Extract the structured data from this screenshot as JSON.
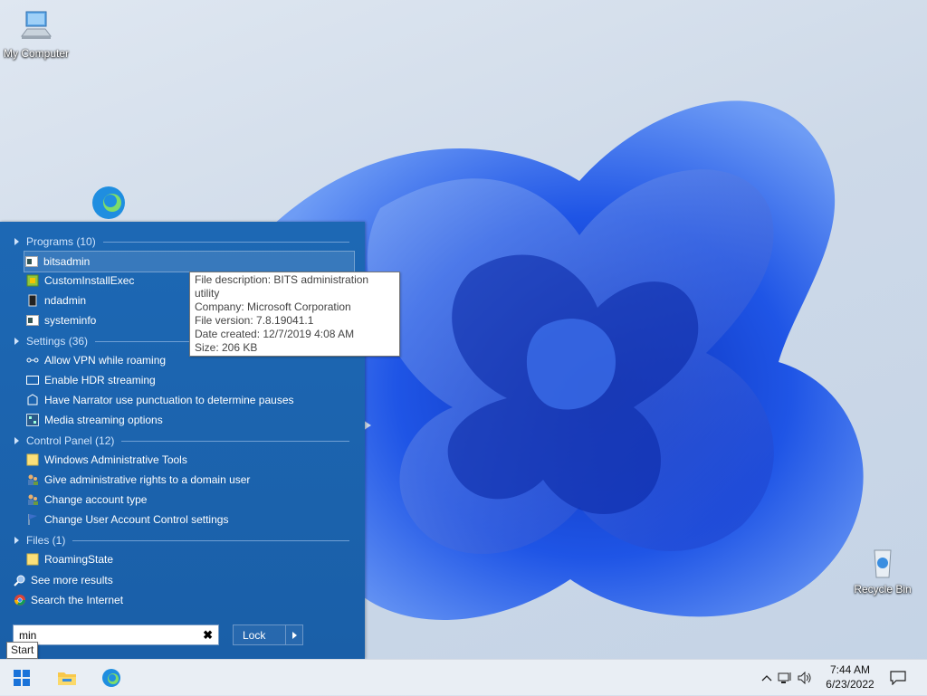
{
  "desktop": {
    "my_computer_label": "My Computer",
    "recycle_bin_label": "Recycle Bin"
  },
  "start_menu": {
    "groups": [
      {
        "header": "Programs (10)",
        "items": [
          "bitsadmin",
          "CustomInstallExec",
          "ndadmin",
          "systeminfo"
        ]
      },
      {
        "header": "Settings (36)",
        "items": [
          "Allow VPN while roaming",
          "Enable HDR streaming",
          "Have Narrator use punctuation to determine pauses",
          "Media streaming options"
        ]
      },
      {
        "header": "Control Panel (12)",
        "items": [
          "Windows Administrative Tools",
          "Give administrative rights to a domain user",
          "Change account type",
          "Change User Account Control settings"
        ]
      },
      {
        "header": "Files (1)",
        "items": [
          "RoamingState"
        ]
      }
    ],
    "see_more": "See more results",
    "search_internet": "Search the Internet",
    "search": {
      "value": "min",
      "clear": "✖"
    },
    "lock_label": "Lock"
  },
  "tooltip": {
    "lines": [
      "File description: BITS administration utility",
      "Company: Microsoft Corporation",
      "File version: 7.8.19041.1",
      "Date created: 12/7/2019 4:08 AM",
      "Size: 206 KB"
    ]
  },
  "start_tooltip": "Start",
  "taskbar": {
    "time": "7:44 AM",
    "date": "6/23/2022"
  },
  "colors": {
    "menu_bg": "#1a62ad",
    "wallpaper_blue": "#1d4fe0",
    "taskbar": "#e9eef4"
  }
}
